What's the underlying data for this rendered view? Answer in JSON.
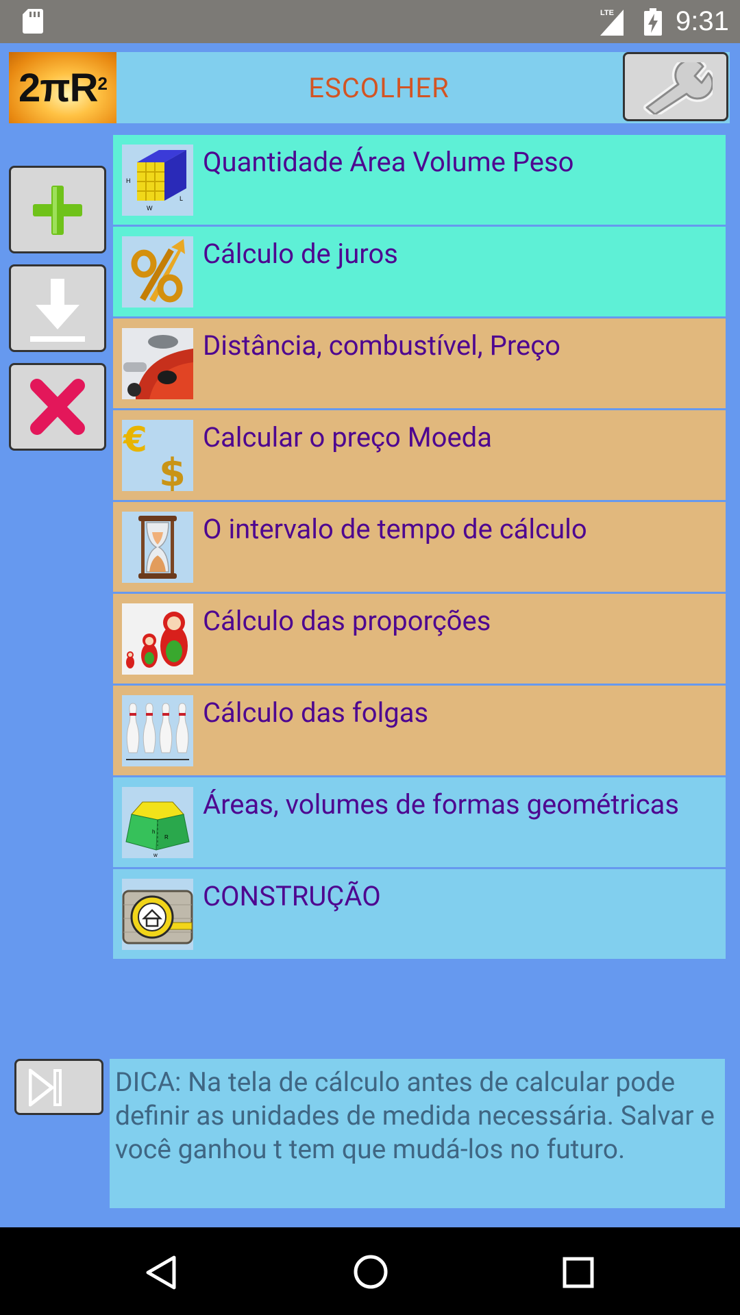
{
  "status_bar": {
    "time": "9:31",
    "network_label": "LTE",
    "icons": [
      "sd-card-icon",
      "lte-signal-icon",
      "battery-charging-icon"
    ]
  },
  "header": {
    "logo_text": "2πR",
    "logo_superscript": "2",
    "title": "ESCOLHER",
    "settings_icon": "wrench-icon"
  },
  "side_buttons": [
    {
      "name": "add-button",
      "icon": "plus-icon"
    },
    {
      "name": "download-button",
      "icon": "download-icon"
    },
    {
      "name": "delete-button",
      "icon": "close-icon"
    }
  ],
  "menu": {
    "items": [
      {
        "label": "Quantidade Área Volume Peso",
        "icon": "cube-volume-icon",
        "color": "#5ef0d6"
      },
      {
        "label": "Cálculo de juros",
        "icon": "percent-icon",
        "color": "#5ef0d6"
      },
      {
        "label": "Distância, combustível, Preço",
        "icon": "fuel-car-icon",
        "color": "#e1b87d"
      },
      {
        "label": "Calcular o preço Moeda",
        "icon": "currency-icon",
        "color": "#e1b87d"
      },
      {
        "label": "O intervalo de tempo de cálculo",
        "icon": "hourglass-icon",
        "color": "#e1b87d"
      },
      {
        "label": "Cálculo das proporções",
        "icon": "matryoshka-icon",
        "color": "#e1b87d"
      },
      {
        "label": "Cálculo das folgas",
        "icon": "bowling-pins-icon",
        "color": "#e1b87d"
      },
      {
        "label": "Áreas, volumes de formas geométricas",
        "icon": "prism-shape-icon",
        "color": "#81cfee"
      },
      {
        "label": "CONSTRUÇÃO",
        "icon": "house-tape-icon",
        "color": "#81cfee"
      }
    ]
  },
  "tip": {
    "text": "DICA: Na tela de cálculo antes de calcular pode definir as unidades de medida necessária. Salvar e você ganhou t tem que mudá-los no futuro.",
    "skip_icon": "skip-next-icon"
  },
  "nav_bar": {
    "icons": [
      "back-icon",
      "home-icon",
      "recents-icon"
    ]
  },
  "colors": {
    "background": "#6699ef",
    "header": "#81cfee",
    "title": "#d35423",
    "item_text": "#4e0790",
    "tip_text": "#3f6683"
  }
}
